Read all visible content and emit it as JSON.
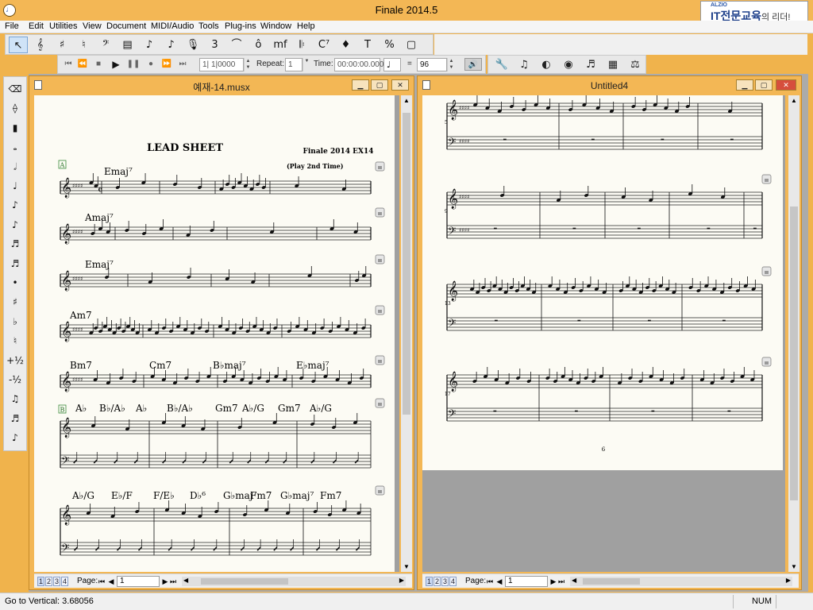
{
  "app": {
    "title": "Finale 2014.5",
    "icon": "finale-app-icon",
    "brand_small": "ALZIO",
    "brand_main": "IT전문교육",
    "brand_tail": "의 리더!"
  },
  "menu": [
    "File",
    "Edit",
    "Utilities",
    "View",
    "Document",
    "MIDI/Audio",
    "Tools",
    "Plug-ins",
    "Window",
    "Help"
  ],
  "toolbar_main": [
    {
      "name": "selection-tool-icon",
      "glyph": "↖",
      "selected": true
    },
    {
      "name": "staff-tool-icon",
      "glyph": "𝄞"
    },
    {
      "name": "key-signature-tool-icon",
      "glyph": "♯"
    },
    {
      "name": "time-signature-tool-icon",
      "glyph": "♮"
    },
    {
      "name": "clef-tool-icon",
      "glyph": "𝄢"
    },
    {
      "name": "measure-tool-icon",
      "glyph": "▤"
    },
    {
      "name": "simple-entry-icon",
      "glyph": "♪"
    },
    {
      "name": "speedy-entry-icon",
      "glyph": "♪"
    },
    {
      "name": "hyperscribe-icon",
      "glyph": "🎙"
    },
    {
      "name": "tuplet-tool-icon",
      "glyph": "3"
    },
    {
      "name": "smart-shape-tool-icon",
      "glyph": "⌒"
    },
    {
      "name": "articulation-tool-icon",
      "glyph": "ô"
    },
    {
      "name": "expression-tool-icon",
      "glyph": "mf"
    },
    {
      "name": "repeat-tool-icon",
      "glyph": "𝄆"
    },
    {
      "name": "chord-tool-icon",
      "glyph": "C⁷"
    },
    {
      "name": "lyrics-tool-icon",
      "glyph": "♦"
    },
    {
      "name": "text-tool-icon",
      "glyph": "T"
    },
    {
      "name": "resize-tool-icon",
      "glyph": "%"
    },
    {
      "name": "page-layout-tool-icon",
      "glyph": "▢"
    }
  ],
  "toolbar_right": [
    {
      "name": "wrench-icon",
      "glyph": "🔧"
    },
    {
      "name": "midi-tool-icon",
      "glyph": "♫"
    },
    {
      "name": "mixer-icon",
      "glyph": "◐"
    },
    {
      "name": "audio-icon",
      "glyph": "◉"
    },
    {
      "name": "beam-icon",
      "glyph": "♬"
    },
    {
      "name": "percussion-icon",
      "glyph": "▦"
    },
    {
      "name": "metronome-icon",
      "glyph": "⚖"
    }
  ],
  "playback": {
    "counter": "1| 1|0000",
    "repeat_label": "Repeat:",
    "repeat_value": "1",
    "time_label": "Time:",
    "time_value": "00:00:00.000",
    "equals": "=",
    "tempo": "96"
  },
  "palette": [
    {
      "name": "eraser-icon",
      "glyph": "⌫"
    },
    {
      "name": "tie-icon",
      "glyph": "⟠"
    },
    {
      "name": "rest-icon",
      "glyph": "▮"
    },
    {
      "name": "whole-note-icon",
      "glyph": "𝅝"
    },
    {
      "name": "half-note-icon",
      "glyph": "𝅗𝅥"
    },
    {
      "name": "quarter-note-icon",
      "glyph": "♩"
    },
    {
      "name": "eighth-note-icon",
      "glyph": "♪"
    },
    {
      "name": "sixteenth-note-icon",
      "glyph": "♪"
    },
    {
      "name": "thirtysecond-note-icon",
      "glyph": "♬"
    },
    {
      "name": "sixtyfourth-note-icon",
      "glyph": "♬"
    },
    {
      "name": "dot-icon",
      "glyph": "•"
    },
    {
      "name": "sharp-icon",
      "glyph": "♯"
    },
    {
      "name": "flat-icon",
      "glyph": "♭"
    },
    {
      "name": "natural-icon",
      "glyph": "♮"
    },
    {
      "name": "half-step-up-icon",
      "glyph": "+½"
    },
    {
      "name": "half-step-down-icon",
      "glyph": "-½"
    },
    {
      "name": "flip-icon",
      "glyph": "♫"
    },
    {
      "name": "tuplet-palette-icon",
      "glyph": "♬"
    },
    {
      "name": "grace-note-icon",
      "glyph": "♪"
    }
  ],
  "left_doc": {
    "title": "예재-14.musx",
    "score_title": "LEAD SHEET",
    "score_subtitle": "Finale 2014 EX14",
    "rehearsal_a": "A",
    "rehearsal_b": "B",
    "annotation": "(Play 2nd Time)",
    "chords": {
      "r1": [
        "Emaj⁷"
      ],
      "r2": [
        "Amaj⁷"
      ],
      "r3": [
        "Emaj⁷"
      ],
      "r4": [
        "Am7"
      ],
      "r5": [
        "Bm7",
        "Cm7",
        "B♭maj⁷",
        "E♭maj⁷"
      ],
      "r6": [
        "A♭",
        "B♭/A♭",
        "A♭",
        "B♭/A♭",
        "Gm7",
        "A♭/G",
        "Gm7",
        "A♭/G"
      ],
      "r7": [
        "A♭/G",
        "E♭/F",
        "F/E♭",
        "D♭⁶",
        "G♭maj⁷",
        "Fm7",
        "G♭maj⁷",
        "Fm7"
      ]
    },
    "page_tabs": [
      "1",
      "2",
      "3",
      "4"
    ],
    "page_label": "Page:",
    "page_value": "1"
  },
  "right_doc": {
    "title": "Untitled4",
    "measure_numbers": [
      "5",
      "9",
      "13",
      "17"
    ],
    "page_number": "6",
    "page_tabs": [
      "1",
      "2",
      "3",
      "4"
    ],
    "page_label": "Page:",
    "page_value": "1"
  },
  "status": {
    "text": "Go to Vertical: 3.68056",
    "num": "NUM"
  },
  "colors": {
    "window_frame": "#f3b755",
    "workspace": "#ababab",
    "paper": "#fcfbf4"
  }
}
